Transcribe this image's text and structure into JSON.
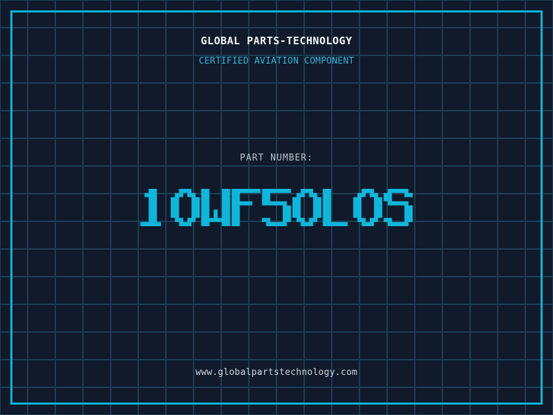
{
  "header": {
    "company": "GLOBAL PARTS-TECHNOLOGY",
    "tagline": "CERTIFIED AVIATION COMPONENT"
  },
  "part": {
    "label": "PART NUMBER:",
    "number": "10WF50L0S"
  },
  "footer": {
    "website": "www.globalpartstechnology.com"
  },
  "colors": {
    "background": "#101a2b",
    "grid_line": "#1d3e54",
    "frame": "#0cb4da",
    "title_text": "#f5f7f8",
    "tagline_text": "#35b2d6",
    "label_text": "#b9c3cb",
    "part_number_text": "#10b6da",
    "footer_text": "#cdd6da"
  }
}
